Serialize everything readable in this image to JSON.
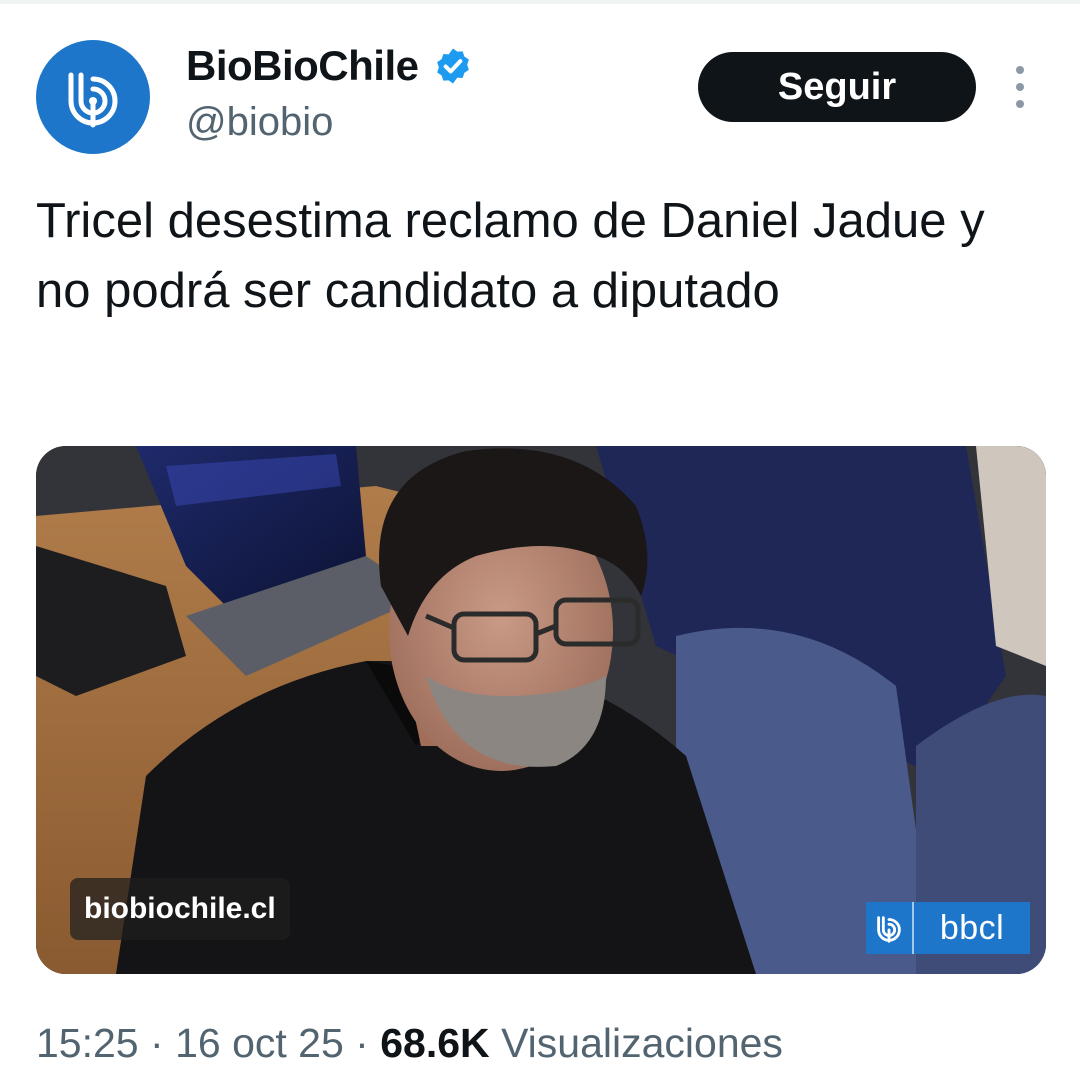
{
  "account": {
    "display_name": "BioBioChile",
    "handle": "@biobio",
    "verified_icon": "verified-badge-icon",
    "avatar_icon": "biobio-logo-icon"
  },
  "actions": {
    "follow_label": "Seguir",
    "more_icon": "more-vertical-icon"
  },
  "tweet": {
    "text": "Tricel desestima reclamo de Daniel Jadue y no podrá ser candidato a diputado"
  },
  "media": {
    "site_label": "biobiochile.cl",
    "badge_text": "bbcl",
    "badge_icon": "biobio-logo-icon"
  },
  "meta": {
    "time": "15:25",
    "separator": "·",
    "date": "16 oct 25",
    "views_count": "68.6K",
    "views_label": "Visualizaciones"
  },
  "colors": {
    "brand_blue": "#1d76c9",
    "verified_blue": "#1d9bf0",
    "text_primary": "#0f1419",
    "text_secondary": "#536471"
  }
}
